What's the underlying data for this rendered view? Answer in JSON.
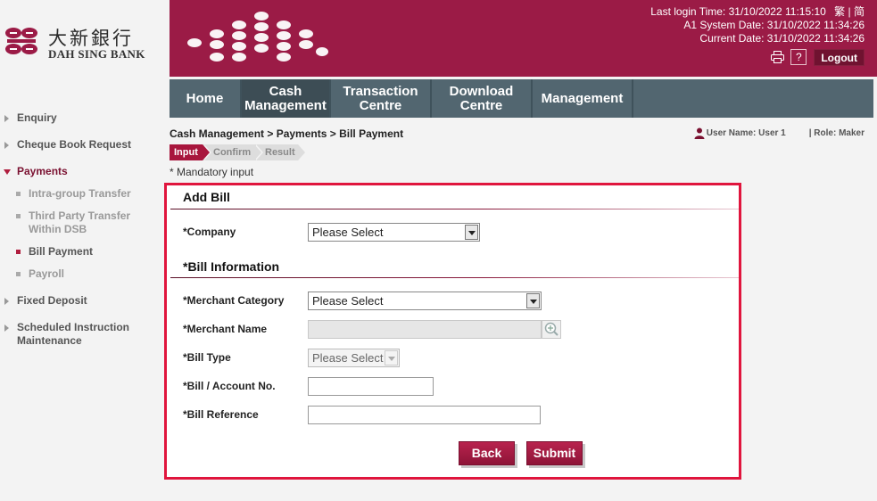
{
  "brand": {
    "name_cn": "大新銀行",
    "name_en": "DAH SING BANK",
    "accent": "#9b1b46"
  },
  "header": {
    "last_login": "Last login Time: 31/10/2022 11:15:10",
    "lang_tc": "繁",
    "lang_sep": "|",
    "lang_sc": "简",
    "system_date": "A1 System Date: 31/10/2022 11:34:26",
    "current_date": "Current Date: 31/10/2022 11:34:26",
    "print_icon": "printer-icon",
    "help_label": "?",
    "logout_label": "Logout"
  },
  "nav": {
    "tabs": [
      {
        "line1": "Home",
        "line2": ""
      },
      {
        "line1": "Cash",
        "line2": "Management"
      },
      {
        "line1": "Transaction",
        "line2": "Centre"
      },
      {
        "line1": "Download",
        "line2": "Centre"
      },
      {
        "line1": "Management",
        "line2": ""
      }
    ]
  },
  "sidebar": {
    "items": [
      {
        "label": "Enquiry"
      },
      {
        "label": "Cheque Book Request"
      },
      {
        "label": "Payments"
      },
      {
        "label": "Fixed Deposit"
      },
      {
        "label": "Scheduled Instruction Maintenance"
      }
    ],
    "payments_sub": [
      {
        "label": "Intra-group Transfer"
      },
      {
        "label": "Third Party Transfer Within DSB"
      },
      {
        "label": "Bill Payment"
      },
      {
        "label": "Payroll"
      }
    ]
  },
  "breadcrumb": "Cash Management > Payments > Bill Payment",
  "user": {
    "name": "User Name: User 1",
    "role": "| Role: Maker"
  },
  "steps": [
    "Input",
    "Confirm",
    "Result"
  ],
  "mandatory_note": "* Mandatory input",
  "form": {
    "add_bill_title": "Add Bill",
    "company_label": "*Company",
    "company_value": "Please Select",
    "bill_info_title": "*Bill Information",
    "merchant_category_label": "*Merchant Category",
    "merchant_category_value": "Please Select",
    "merchant_name_label": "*Merchant Name",
    "merchant_name_value": "",
    "bill_type_label": "*Bill Type",
    "bill_type_value": "Please Select",
    "bill_account_label": "*Bill / Account No.",
    "bill_account_value": "",
    "bill_reference_label": "*Bill Reference",
    "bill_reference_value": "",
    "back_label": "Back",
    "submit_label": "Submit"
  }
}
